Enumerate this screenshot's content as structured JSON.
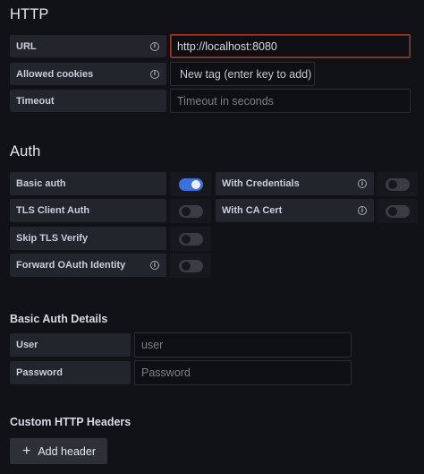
{
  "http": {
    "title": "HTTP",
    "url_label": "URL",
    "url_value": "http://localhost:8080",
    "cookies_label": "Allowed cookies",
    "cookies_placeholder": "New tag (enter key to add)",
    "timeout_label": "Timeout",
    "timeout_placeholder": "Timeout in seconds"
  },
  "auth": {
    "title": "Auth",
    "basic_auth_label": "Basic auth",
    "basic_auth_on": true,
    "with_credentials_label": "With Credentials",
    "with_credentials_on": false,
    "tls_client_auth_label": "TLS Client Auth",
    "tls_client_auth_on": false,
    "with_ca_cert_label": "With CA Cert",
    "with_ca_cert_on": false,
    "skip_tls_label": "Skip TLS Verify",
    "skip_tls_on": false,
    "forward_oauth_label": "Forward OAuth Identity",
    "forward_oauth_on": false
  },
  "basic_auth_details": {
    "title": "Basic Auth Details",
    "user_label": "User",
    "user_placeholder": "user",
    "password_label": "Password",
    "password_placeholder": "Password"
  },
  "custom_headers": {
    "title": "Custom HTTP Headers",
    "add_button_label": "Add header",
    "add_icon": "plus-icon"
  },
  "colors": {
    "background": "#111217",
    "toggle_on": "#3d71d9",
    "focus_border": "#8b3e2d"
  }
}
